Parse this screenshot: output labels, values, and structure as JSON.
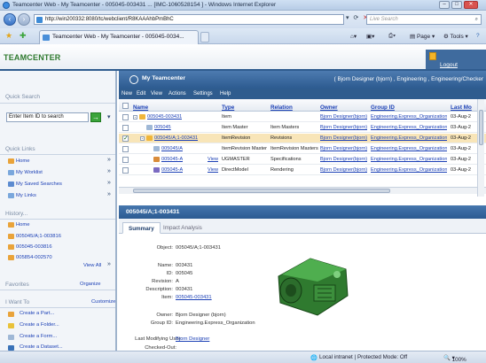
{
  "browser": {
    "title": "Teamcenter Web - My Teamcenter - 005045-003431 ... [IMC-1060528154 ] - Windows Internet Explorer",
    "url": "http://win200332:8080/tc/webclient/R8KAAAhbPmBhC",
    "search_placeholder": "Live Search",
    "tab_title": "Teamcenter Web - My Teamcenter - 005045-0034...",
    "commands": {
      "page": "Page",
      "tools": "Tools"
    }
  },
  "app": {
    "logo": "TEAMCENTER",
    "logout": "Logout",
    "heading": "My Teamcenter",
    "user_context": "( Bjorn Designer (bjorn) , Engineering , Engineering/Checker"
  },
  "left": {
    "quick_search": {
      "title": "Quick Search",
      "input_value": "Enter Item ID to search",
      "go": "→"
    },
    "quick_links": {
      "title": "Quick Links",
      "items": [
        "Home",
        "My Worklist",
        "My Saved Searches",
        "My Links"
      ]
    },
    "history": {
      "title": "History...",
      "items": [
        "Home",
        "005045/A;1-003816",
        "005045-003816",
        "005854-002570"
      ],
      "view_all": "View All"
    },
    "favorites": {
      "title": "Favorites",
      "organize": "Organize"
    },
    "i_want_to": {
      "title": "I Want To",
      "customize": "Customize",
      "items": [
        "Create a Part...",
        "Create a Folder...",
        "Create a Form...",
        "Create a Dataset..."
      ]
    }
  },
  "menu": [
    "New",
    "Edit",
    "View",
    "Actions",
    "Settings",
    "Help"
  ],
  "grid": {
    "columns": [
      "Name",
      "Type",
      "Relation",
      "Owner",
      "Group ID",
      "Last Mo"
    ],
    "rows": [
      {
        "name": "005045-003431",
        "view": "",
        "type": "Item",
        "relation": "",
        "owner": "Bjorn Designer(bjorn)",
        "group": "Engineering.Express_Organization",
        "date": "03-Aug-2",
        "selected": false,
        "checked": false,
        "tree": "-",
        "indent": 0,
        "color": "#f0b63a"
      },
      {
        "name": "005045",
        "view": "",
        "type": "Item Master",
        "relation": "Item Masters",
        "owner": "Bjorn Designer(bjorn)",
        "group": "Engineering.Express_Organization",
        "date": "03-Aug-2",
        "selected": false,
        "checked": false,
        "tree": "",
        "indent": 1,
        "color": "#9fb8d6"
      },
      {
        "name": "005045/A;1-003431",
        "view": "",
        "type": "ItemRevision",
        "relation": "Revisions",
        "owner": "Bjorn Designer(bjorn)",
        "group": "Engineering.Express_Organization",
        "date": "03-Aug-2",
        "selected": true,
        "checked": true,
        "tree": "-",
        "indent": 1,
        "color": "#f0b63a"
      },
      {
        "name": "005045/A",
        "view": "",
        "type": "ItemRevision Master",
        "relation": "ItemRevision Masters",
        "owner": "Bjorn Designer(bjorn)",
        "group": "Engineering.Express_Organization",
        "date": "03-Aug-2",
        "selected": false,
        "checked": false,
        "tree": "",
        "indent": 2,
        "color": "#9fb8d6"
      },
      {
        "name": "005045-A",
        "view": "View",
        "type": "UGMASTER",
        "relation": "Specifications",
        "owner": "Bjorn Designer(bjorn)",
        "group": "Engineering.Express_Organization",
        "date": "03-Aug-2",
        "selected": false,
        "checked": false,
        "tree": "",
        "indent": 2,
        "color": "#d98c3a"
      },
      {
        "name": "005045-A",
        "view": "View",
        "type": "DirectModel",
        "relation": "Rendering",
        "owner": "Bjorn Designer(bjorn)",
        "group": "Engineering.Express_Organization",
        "date": "03-Aug-2",
        "selected": false,
        "checked": false,
        "tree": "",
        "indent": 2,
        "color": "#7b6bc2"
      }
    ]
  },
  "detail": {
    "title": "005045/A;1-003431",
    "tabs": [
      "Summary",
      "Impact Analysis"
    ],
    "object_label": "Object:",
    "object_value": "005045/A;1-003431",
    "props": [
      {
        "label": "Name:",
        "value": "003431",
        "link": false
      },
      {
        "label": "ID:",
        "value": "005045",
        "link": false
      },
      {
        "label": "Revision:",
        "value": "A",
        "link": false
      },
      {
        "label": "Description:",
        "value": "003431",
        "link": false
      },
      {
        "label": "Item:",
        "value": "005045-003431",
        "link": true
      }
    ],
    "owner_props": [
      {
        "label": "Owner:",
        "value": "Bjorn Designer (bjorn)",
        "link": false
      },
      {
        "label": "Group ID:",
        "value": "Engineering.Express_Organization",
        "link": false
      }
    ],
    "last_modifying_label": "Last Modifying User:",
    "last_modifying_value": "Bjorn Designer",
    "checked_out_label": "Checked-Out:"
  },
  "status": {
    "zone": "Local intranet | Protected Mode: Off",
    "zoom": "100%"
  }
}
